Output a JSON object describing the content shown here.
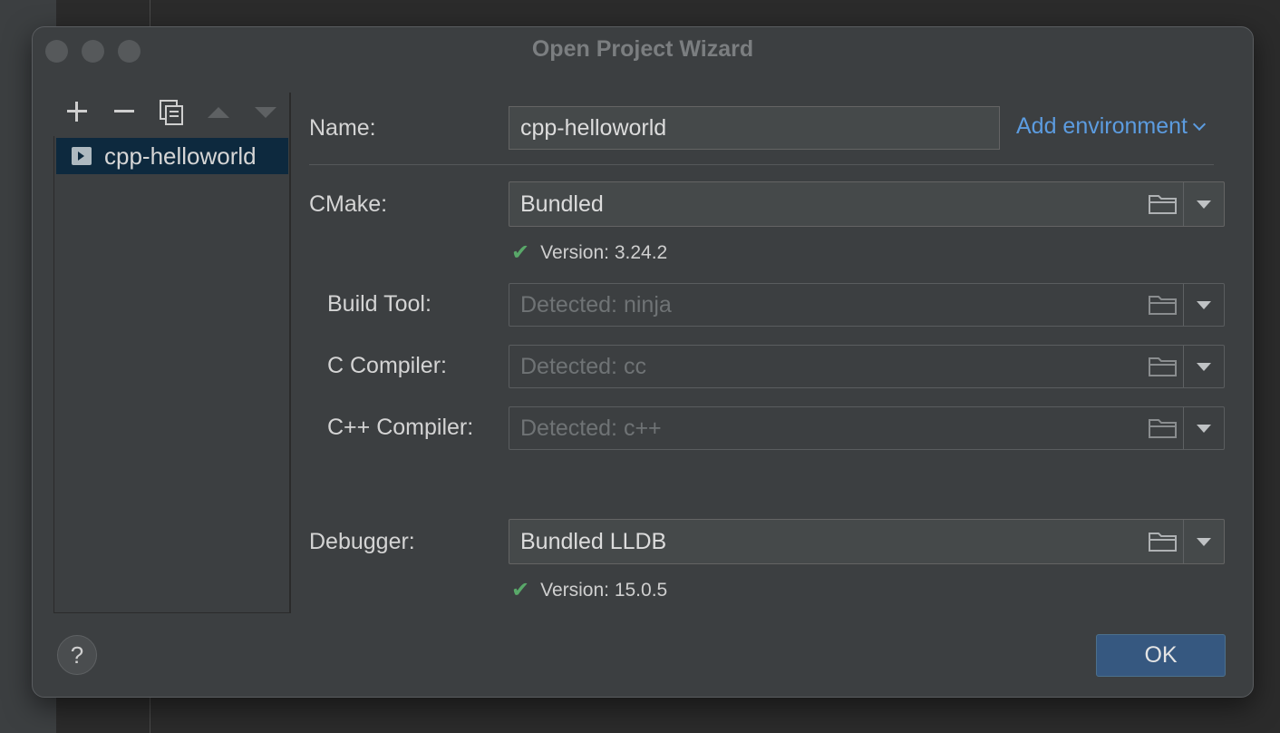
{
  "window": {
    "title": "Open Project Wizard"
  },
  "toolbar": {
    "add_icon": "plus-icon",
    "remove_icon": "minus-icon",
    "copy_icon": "copy-icon",
    "up_icon": "arrow-up-icon",
    "down_icon": "arrow-down-icon"
  },
  "list": {
    "items": [
      {
        "label": "cpp-helloworld",
        "icon": "cmake-profile-icon",
        "selected": true
      }
    ]
  },
  "form": {
    "name": {
      "label": "Name:",
      "value": "cpp-helloworld"
    },
    "add_environment": "Add environment",
    "cmake": {
      "label": "CMake:",
      "value": "Bundled",
      "version": "Version: 3.24.2"
    },
    "build_tool": {
      "label": "Build Tool:",
      "placeholder": "Detected: ninja"
    },
    "c_compiler": {
      "label": "C Compiler:",
      "placeholder": "Detected: cc"
    },
    "cpp_compiler": {
      "label": "C++ Compiler:",
      "placeholder": "Detected: c++"
    },
    "debugger": {
      "label": "Debugger:",
      "value": "Bundled LLDB",
      "version": "Version: 15.0.5"
    }
  },
  "footer": {
    "help": "?",
    "ok": "OK"
  },
  "colors": {
    "accent_link": "#5c9ce0",
    "ok_button": "#365880",
    "selection": "#0d293e",
    "check": "#59a869"
  }
}
